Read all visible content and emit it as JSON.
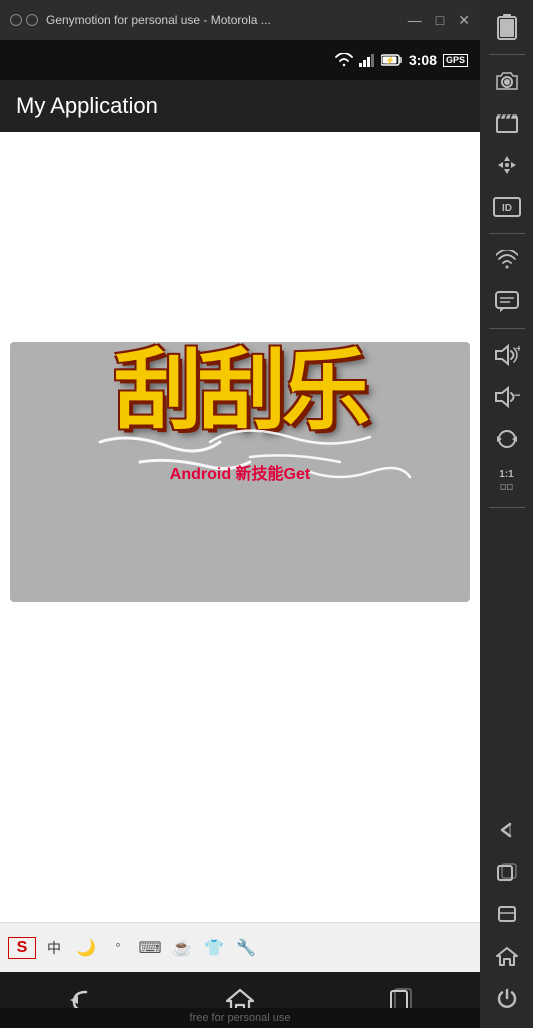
{
  "titlebar": {
    "title": "Genymotion for personal use - Motorola ...",
    "minimize": "—",
    "maximize": "□",
    "close": "✕"
  },
  "statusbar": {
    "time": "3:08",
    "gps": "GPS"
  },
  "appbar": {
    "title": "My Application"
  },
  "overlay": {
    "text": "Android 新技能Get"
  },
  "chinese_art": {
    "text": "刮刮乐"
  },
  "inputbar": {
    "icons": [
      "S",
      "中",
      "🌙",
      "°",
      "⌨",
      "☕",
      "👕",
      "🔧"
    ]
  },
  "navbar": {
    "back": "←",
    "home": "⌂",
    "recents": "▭"
  },
  "watermark": {
    "text": "free for personal use"
  },
  "sidebar": {
    "icons": [
      "🔋",
      "📷",
      "🎬",
      "✛",
      "ID",
      "📶",
      "💬",
      "🔊+",
      "🔉",
      "↺",
      "1:1",
      "←",
      "▭",
      "▭",
      "⌂",
      "⏻"
    ]
  }
}
